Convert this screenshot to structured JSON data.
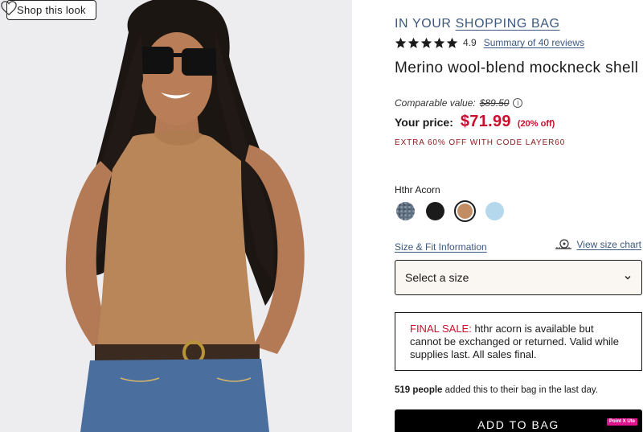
{
  "photo": {
    "shop_look_label": "Shop this look",
    "heart_icon": "heart-outline-icon"
  },
  "product": {
    "bag_prefix": "IN YOUR",
    "bag_link": "SHOPPING BAG",
    "rating_value": "4.9",
    "rating_stars": 5,
    "reviews_link": "Summary of 40 reviews",
    "title": "Merino wool-blend mockneck shell",
    "comparable_label": "Comparable value:",
    "comparable_price": "$89.50",
    "price_label": "Your price:",
    "price": "$71.99",
    "discount": "(20% off)",
    "promo": "EXTRA 60% OFF WITH CODE LAYER60",
    "color_name": "Hthr Acorn",
    "swatches": [
      {
        "name": "Heather Denim",
        "color": "#5f6e80",
        "selected": false
      },
      {
        "name": "Black",
        "color": "#1b1b1b",
        "selected": false
      },
      {
        "name": "Hthr Acorn",
        "color": "#c28d62",
        "selected": true
      },
      {
        "name": "Light Blue",
        "color": "#b6d8ec",
        "selected": false
      }
    ],
    "fit_link": "Size & Fit Information",
    "size_chart_link": "View size chart",
    "size_select_placeholder": "Select a size",
    "final_sale_label": "FINAL SALE:",
    "final_sale_text": " hthr acorn is available but cannot be exchanged or returned. Valid while supplies last. All sales final.",
    "social_count": "519 people",
    "social_text": " added this to their bag in the last day.",
    "add_button": "ADD TO BAG",
    "pointx_badge": "Point X Ute"
  },
  "colors": {
    "accent_link": "#3c5780",
    "sale_red": "#c8102e",
    "promo_red": "#8b1a1a",
    "button_bg": "#000000"
  }
}
